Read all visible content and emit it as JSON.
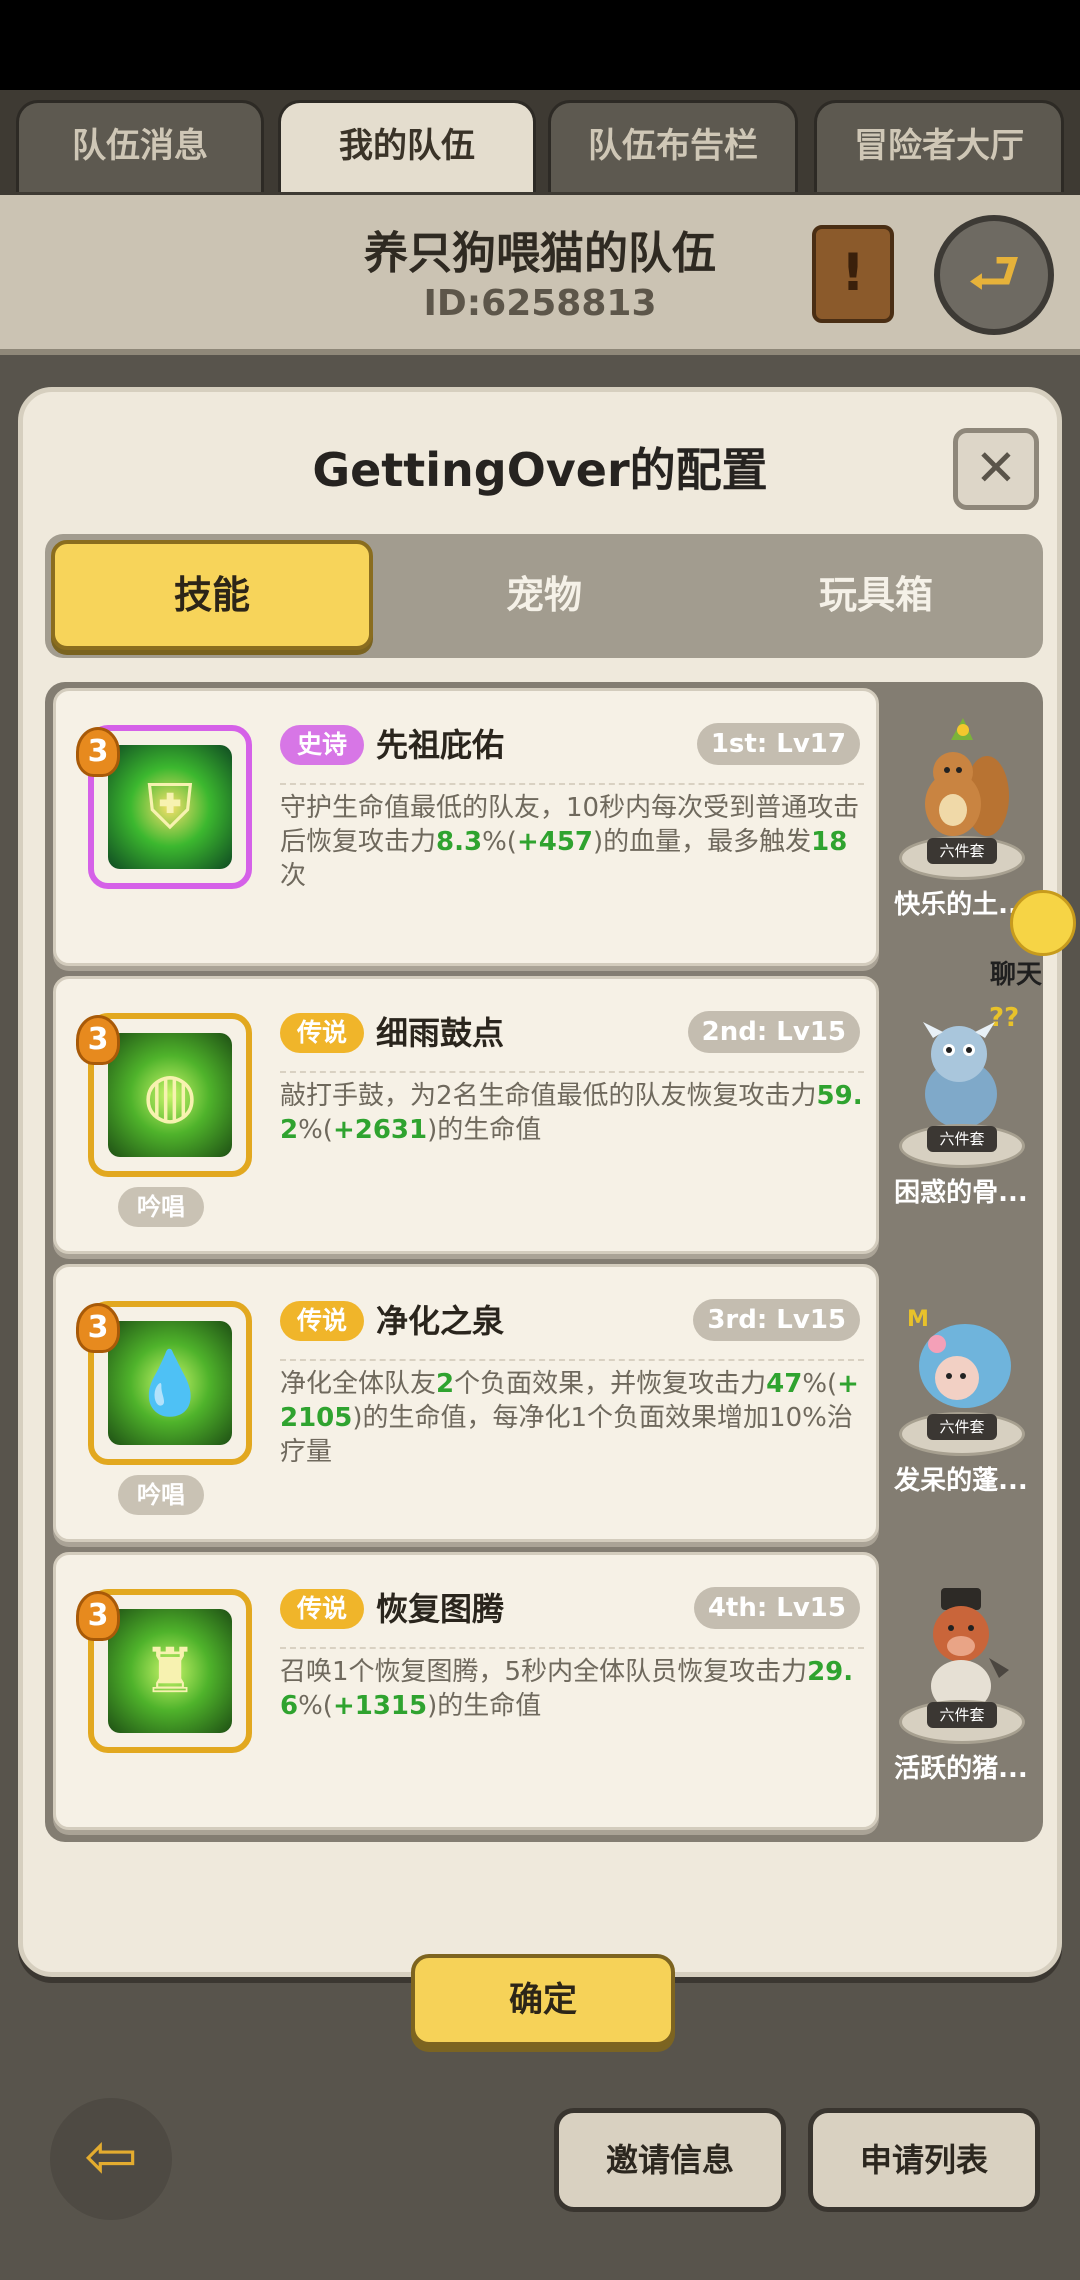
{
  "top_tabs": [
    {
      "label": "队伍消息"
    },
    {
      "label": "我的队伍"
    },
    {
      "label": "队伍布告栏"
    },
    {
      "label": "冒险者大厅"
    }
  ],
  "team": {
    "name": "养只狗喂猫的队伍",
    "id": "ID:6258813"
  },
  "dialog": {
    "title": "GettingOver的配置",
    "close_glyph": "✕",
    "tabs": [
      {
        "label": "技能"
      },
      {
        "label": "宠物"
      },
      {
        "label": "玩具箱"
      }
    ],
    "confirm_label": "确定"
  },
  "skills": [
    {
      "level": "3",
      "rarity": "史诗",
      "name": "先祖庇佑",
      "slot": "1st: Lv17",
      "tag": "",
      "desc": [
        {
          "t": "守护生命值最低的队友，10秒内每次受到普通攻击后恢复攻击力",
          "hl": false
        },
        {
          "t": "8.3",
          "hl": true
        },
        {
          "t": "%(",
          "hl": false
        },
        {
          "t": "+457",
          "hl": true
        },
        {
          "t": ")的血量，最多触发",
          "hl": false
        },
        {
          "t": "18",
          "hl": true
        },
        {
          "t": "次",
          "hl": false
        }
      ],
      "pet_name": "快乐的土..."
    },
    {
      "level": "3",
      "rarity": "传说",
      "name": "细雨鼓点",
      "slot": "2nd: Lv15",
      "tag": "吟唱",
      "desc": [
        {
          "t": "敲打手鼓，为2名生命值最低的队友恢复攻击力",
          "hl": false
        },
        {
          "t": "59.2",
          "hl": true
        },
        {
          "t": "%(",
          "hl": false
        },
        {
          "t": "+2631",
          "hl": true
        },
        {
          "t": ")的生命值",
          "hl": false
        }
      ],
      "pet_name": "困惑的骨..."
    },
    {
      "level": "3",
      "rarity": "传说",
      "name": "净化之泉",
      "slot": "3rd: Lv15",
      "tag": "吟唱",
      "desc": [
        {
          "t": "净化全体队友",
          "hl": false
        },
        {
          "t": "2",
          "hl": true
        },
        {
          "t": "个负面效果，并恢复攻击力",
          "hl": false
        },
        {
          "t": "47",
          "hl": true
        },
        {
          "t": "%(",
          "hl": false
        },
        {
          "t": "+2105",
          "hl": true
        },
        {
          "t": ")的生命值，每净化1个负面效果增加10%治疗量",
          "hl": false
        }
      ],
      "pet_name": "发呆的蓬..."
    },
    {
      "level": "3",
      "rarity": "传说",
      "name": "恢复图腾",
      "slot": "4th: Lv15",
      "tag": "",
      "desc": [
        {
          "t": "召唤1个恢复图腾，5秒内全体队员恢复攻击力",
          "hl": false
        },
        {
          "t": "29.6",
          "hl": true
        },
        {
          "t": "%(",
          "hl": false
        },
        {
          "t": "+1315",
          "hl": true
        },
        {
          "t": ")的生命值",
          "hl": false
        }
      ],
      "pet_name": "活跃的猪..."
    }
  ],
  "pet_set_label": "六件套",
  "chat": {
    "label": "聊天"
  },
  "bottom": {
    "invite_label": "邀请信息",
    "apply_label": "申请列表"
  },
  "colors": {
    "accent_yellow": "#f7d45a",
    "highlight_green": "#2fa32f",
    "epic_purple": "#d776e6",
    "legend_gold": "#f0b52a"
  }
}
